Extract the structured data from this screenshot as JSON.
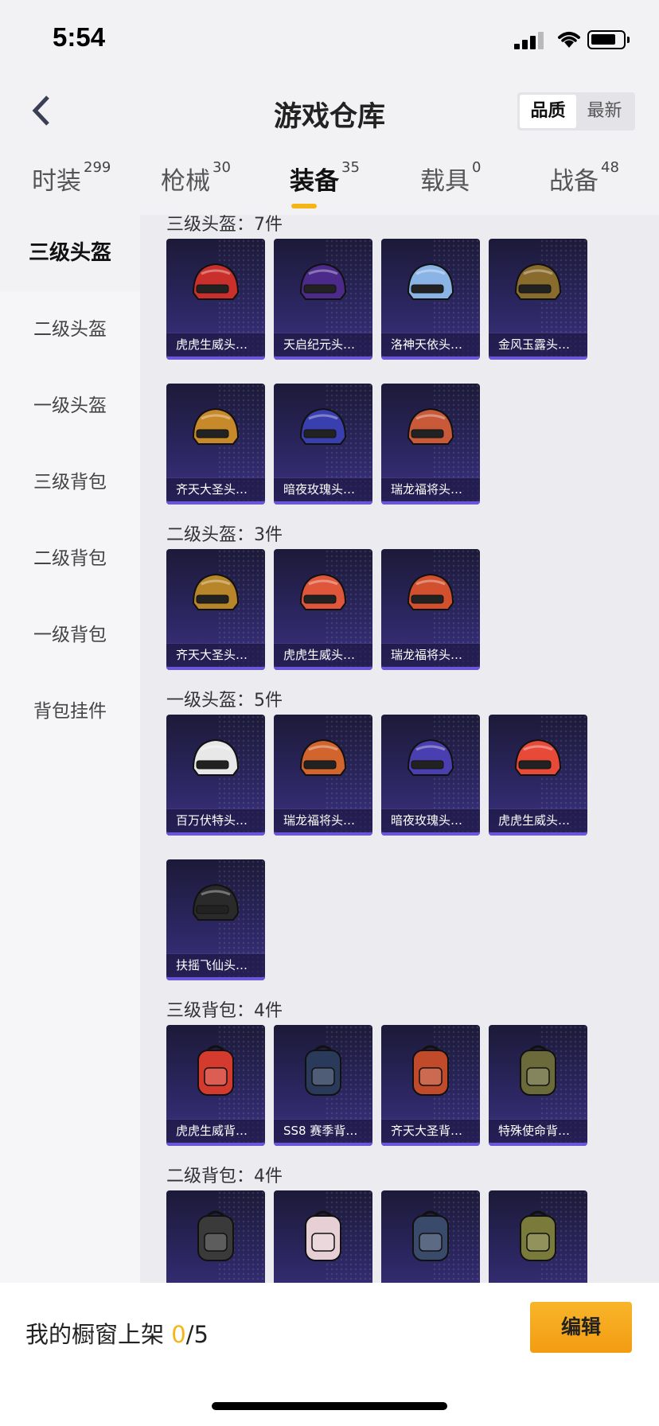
{
  "status_bar": {
    "time": "5:54"
  },
  "header": {
    "title": "游戏仓库",
    "sort_options": [
      "品质",
      "最新"
    ]
  },
  "tabs": [
    {
      "label": "时装",
      "count": "299"
    },
    {
      "label": "枪械",
      "count": "30"
    },
    {
      "label": "装备",
      "count": "35"
    },
    {
      "label": "载具",
      "count": "0"
    },
    {
      "label": "战备",
      "count": "48"
    }
  ],
  "sidebar": {
    "items": [
      "三级头盔",
      "二级头盔",
      "一级头盔",
      "三级背包",
      "二级背包",
      "一级背包",
      "背包挂件"
    ]
  },
  "sections": [
    {
      "title": "三级头盔：7件",
      "items": [
        {
          "label": "虎虎生威头…",
          "color": "#c9302c"
        },
        {
          "label": "天启纪元头…",
          "color": "#4b2a8a"
        },
        {
          "label": "洛神天依头…",
          "color": "#8ab4e6"
        },
        {
          "label": "金风玉露头…",
          "color": "#8a6b2e"
        },
        {
          "label": "齐天大圣头…",
          "color": "#c8892a"
        },
        {
          "label": "暗夜玫瑰头…",
          "color": "#3a3fb0"
        },
        {
          "label": "瑞龙福将头…",
          "color": "#c85a3a"
        }
      ]
    },
    {
      "title": "二级头盔：3件",
      "items": [
        {
          "label": "齐天大圣头…",
          "color": "#b8862a"
        },
        {
          "label": "虎虎生威头…",
          "color": "#e0563a"
        },
        {
          "label": "瑞龙福将头…",
          "color": "#d2502e"
        }
      ]
    },
    {
      "title": "一级头盔：5件",
      "items": [
        {
          "label": "百万伏特头…",
          "color": "#e8e8e8"
        },
        {
          "label": "瑞龙福将头…",
          "color": "#d2642e"
        },
        {
          "label": "暗夜玫瑰头…",
          "color": "#4a3fb0"
        },
        {
          "label": "虎虎生威头…",
          "color": "#e84a3a"
        },
        {
          "label": "扶摇飞仙头…",
          "color": "#2a2a2a"
        }
      ]
    },
    {
      "title": "三级背包：4件",
      "items": [
        {
          "label": "虎虎生威背…",
          "color": "#d43a2e"
        },
        {
          "label": "SS8 赛季背…",
          "color": "#2a3a5a"
        },
        {
          "label": "齐天大圣背…",
          "color": "#c04a2a"
        },
        {
          "label": "特殊使命背…",
          "color": "#6a6a3a"
        }
      ]
    },
    {
      "title": "二级背包：4件",
      "items": [
        {
          "label": "",
          "color": "#3a3a3a"
        },
        {
          "label": "",
          "color": "#e6d0d6"
        },
        {
          "label": "",
          "color": "#3a4a6a"
        },
        {
          "label": "",
          "color": "#7a7a3a"
        }
      ]
    }
  ],
  "bottom_bar": {
    "shelf_label": "我的橱窗上架",
    "shelf_current": "0",
    "shelf_total": "/5",
    "edit_label": "编辑"
  }
}
